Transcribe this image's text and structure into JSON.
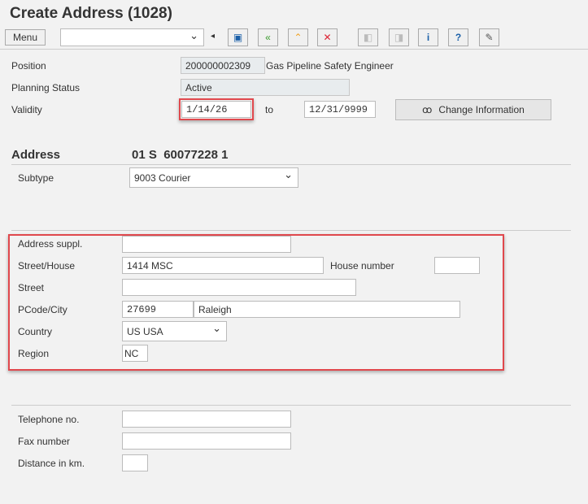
{
  "title": "Create Address (1028)",
  "toolbar": {
    "menu_label": "Menu",
    "command_value": "",
    "icons": [
      "save-icon",
      "back-icon",
      "exit-icon",
      "cancel-icon",
      "previous-icon",
      "next-icon",
      "info-icon",
      "help-icon",
      "customize-icon"
    ]
  },
  "header": {
    "position_label": "Position",
    "position_id": "200000002309",
    "position_name": "Gas Pipeline Safety Engineer",
    "planning_status_label": "Planning Status",
    "planning_status": "Active",
    "validity_label": "Validity",
    "valid_from": "1/14/26",
    "to_label": "to",
    "valid_to": "12/31/9999",
    "change_info_label": "Change Information"
  },
  "address": {
    "heading": "Address",
    "key": "01 S  60077228 1",
    "subtype_label": "Subtype",
    "subtype": "9003 Courier",
    "addr_suppl_label": "Address suppl.",
    "addr_suppl": "",
    "street_house_label": "Street/House",
    "street_house": "1414 MSC",
    "house_number_label": "House number",
    "house_number": "",
    "street_label": "Street",
    "street": "",
    "pcode_city_label": "PCode/City",
    "pcode": "27699",
    "city": "Raleigh",
    "country_label": "Country",
    "country": "US USA",
    "region_label": "Region",
    "region": "NC",
    "telephone_label": "Telephone no.",
    "telephone": "",
    "fax_label": "Fax number",
    "fax": "",
    "distance_label": "Distance in km.",
    "distance": ""
  },
  "colors": {
    "highlight": "#e0484d"
  }
}
